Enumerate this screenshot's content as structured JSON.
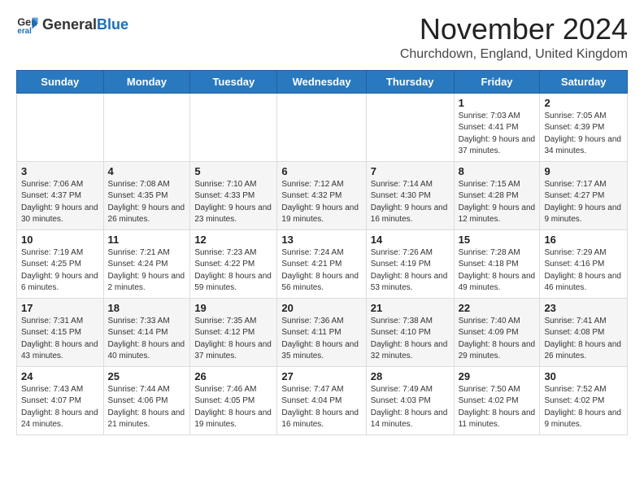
{
  "logo": {
    "text_general": "General",
    "text_blue": "Blue"
  },
  "title": "November 2024",
  "location": "Churchdown, England, United Kingdom",
  "days_of_week": [
    "Sunday",
    "Monday",
    "Tuesday",
    "Wednesday",
    "Thursday",
    "Friday",
    "Saturday"
  ],
  "weeks": [
    [
      {
        "day": "",
        "info": ""
      },
      {
        "day": "",
        "info": ""
      },
      {
        "day": "",
        "info": ""
      },
      {
        "day": "",
        "info": ""
      },
      {
        "day": "",
        "info": ""
      },
      {
        "day": "1",
        "info": "Sunrise: 7:03 AM\nSunset: 4:41 PM\nDaylight: 9 hours and 37 minutes."
      },
      {
        "day": "2",
        "info": "Sunrise: 7:05 AM\nSunset: 4:39 PM\nDaylight: 9 hours and 34 minutes."
      }
    ],
    [
      {
        "day": "3",
        "info": "Sunrise: 7:06 AM\nSunset: 4:37 PM\nDaylight: 9 hours and 30 minutes."
      },
      {
        "day": "4",
        "info": "Sunrise: 7:08 AM\nSunset: 4:35 PM\nDaylight: 9 hours and 26 minutes."
      },
      {
        "day": "5",
        "info": "Sunrise: 7:10 AM\nSunset: 4:33 PM\nDaylight: 9 hours and 23 minutes."
      },
      {
        "day": "6",
        "info": "Sunrise: 7:12 AM\nSunset: 4:32 PM\nDaylight: 9 hours and 19 minutes."
      },
      {
        "day": "7",
        "info": "Sunrise: 7:14 AM\nSunset: 4:30 PM\nDaylight: 9 hours and 16 minutes."
      },
      {
        "day": "8",
        "info": "Sunrise: 7:15 AM\nSunset: 4:28 PM\nDaylight: 9 hours and 12 minutes."
      },
      {
        "day": "9",
        "info": "Sunrise: 7:17 AM\nSunset: 4:27 PM\nDaylight: 9 hours and 9 minutes."
      }
    ],
    [
      {
        "day": "10",
        "info": "Sunrise: 7:19 AM\nSunset: 4:25 PM\nDaylight: 9 hours and 6 minutes."
      },
      {
        "day": "11",
        "info": "Sunrise: 7:21 AM\nSunset: 4:24 PM\nDaylight: 9 hours and 2 minutes."
      },
      {
        "day": "12",
        "info": "Sunrise: 7:23 AM\nSunset: 4:22 PM\nDaylight: 8 hours and 59 minutes."
      },
      {
        "day": "13",
        "info": "Sunrise: 7:24 AM\nSunset: 4:21 PM\nDaylight: 8 hours and 56 minutes."
      },
      {
        "day": "14",
        "info": "Sunrise: 7:26 AM\nSunset: 4:19 PM\nDaylight: 8 hours and 53 minutes."
      },
      {
        "day": "15",
        "info": "Sunrise: 7:28 AM\nSunset: 4:18 PM\nDaylight: 8 hours and 49 minutes."
      },
      {
        "day": "16",
        "info": "Sunrise: 7:29 AM\nSunset: 4:16 PM\nDaylight: 8 hours and 46 minutes."
      }
    ],
    [
      {
        "day": "17",
        "info": "Sunrise: 7:31 AM\nSunset: 4:15 PM\nDaylight: 8 hours and 43 minutes."
      },
      {
        "day": "18",
        "info": "Sunrise: 7:33 AM\nSunset: 4:14 PM\nDaylight: 8 hours and 40 minutes."
      },
      {
        "day": "19",
        "info": "Sunrise: 7:35 AM\nSunset: 4:12 PM\nDaylight: 8 hours and 37 minutes."
      },
      {
        "day": "20",
        "info": "Sunrise: 7:36 AM\nSunset: 4:11 PM\nDaylight: 8 hours and 35 minutes."
      },
      {
        "day": "21",
        "info": "Sunrise: 7:38 AM\nSunset: 4:10 PM\nDaylight: 8 hours and 32 minutes."
      },
      {
        "day": "22",
        "info": "Sunrise: 7:40 AM\nSunset: 4:09 PM\nDaylight: 8 hours and 29 minutes."
      },
      {
        "day": "23",
        "info": "Sunrise: 7:41 AM\nSunset: 4:08 PM\nDaylight: 8 hours and 26 minutes."
      }
    ],
    [
      {
        "day": "24",
        "info": "Sunrise: 7:43 AM\nSunset: 4:07 PM\nDaylight: 8 hours and 24 minutes."
      },
      {
        "day": "25",
        "info": "Sunrise: 7:44 AM\nSunset: 4:06 PM\nDaylight: 8 hours and 21 minutes."
      },
      {
        "day": "26",
        "info": "Sunrise: 7:46 AM\nSunset: 4:05 PM\nDaylight: 8 hours and 19 minutes."
      },
      {
        "day": "27",
        "info": "Sunrise: 7:47 AM\nSunset: 4:04 PM\nDaylight: 8 hours and 16 minutes."
      },
      {
        "day": "28",
        "info": "Sunrise: 7:49 AM\nSunset: 4:03 PM\nDaylight: 8 hours and 14 minutes."
      },
      {
        "day": "29",
        "info": "Sunrise: 7:50 AM\nSunset: 4:02 PM\nDaylight: 8 hours and 11 minutes."
      },
      {
        "day": "30",
        "info": "Sunrise: 7:52 AM\nSunset: 4:02 PM\nDaylight: 8 hours and 9 minutes."
      }
    ]
  ]
}
